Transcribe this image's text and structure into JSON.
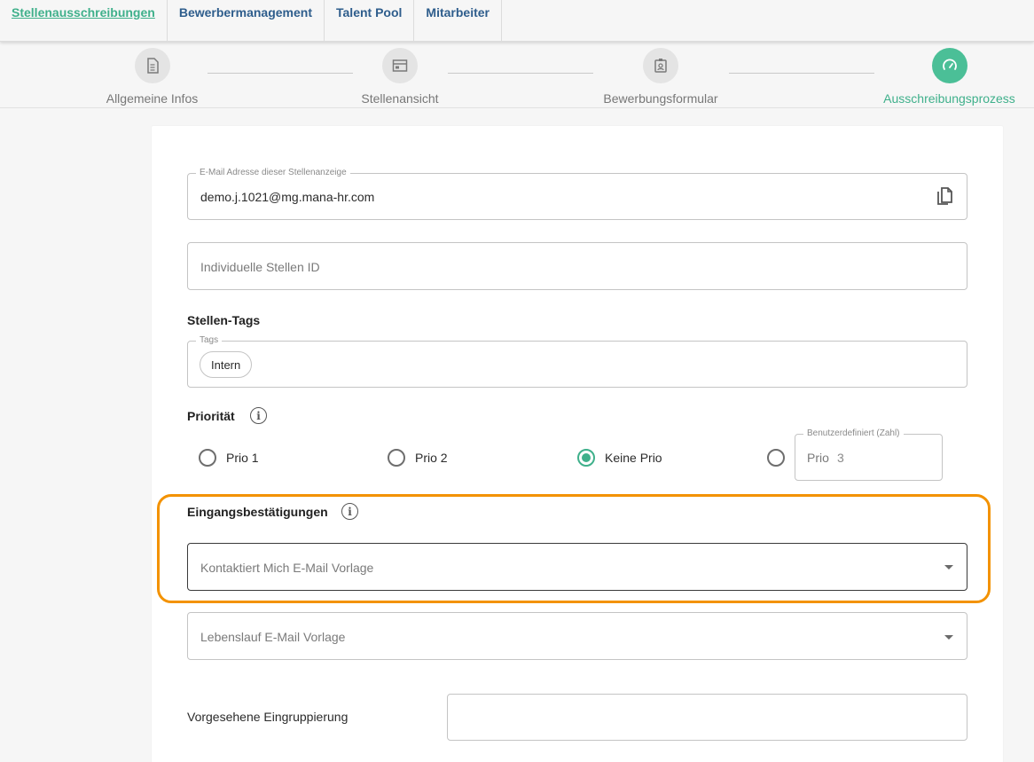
{
  "nav": {
    "tabs": [
      {
        "label": "Stellenausschreibungen",
        "active": true
      },
      {
        "label": "Bewerbermanagement"
      },
      {
        "label": "Talent Pool"
      },
      {
        "label": "Mitarbeiter"
      }
    ]
  },
  "stepper": {
    "steps": [
      {
        "label": "Allgemeine Infos",
        "icon": "document-icon"
      },
      {
        "label": "Stellenansicht",
        "icon": "browser-window-icon"
      },
      {
        "label": "Bewerbungsformular",
        "icon": "id-badge-icon"
      },
      {
        "label": "Ausschreibungsprozess",
        "icon": "speedometer-icon",
        "active": true
      }
    ]
  },
  "form": {
    "email": {
      "legend": "E-Mail Adresse dieser Stellenanzeige",
      "value": "demo.j.1021@mg.mana-hr.com",
      "icon": "copy-icon"
    },
    "stellen_id": {
      "placeholder": "Individuelle Stellen ID"
    },
    "tags_section": {
      "label": "Stellen-Tags",
      "legend": "Tags",
      "chips": [
        "Intern"
      ]
    },
    "priority": {
      "label": "Priorität",
      "options": [
        "Prio 1",
        "Prio 2",
        "Keine Prio"
      ],
      "selected": "Keine Prio",
      "custom": {
        "legend": "Benutzerdefiniert (Zahl)",
        "prefix": "Prio",
        "value": "3"
      }
    },
    "confirmations": {
      "label": "Eingangsbestätigungen",
      "contact_select": "Kontaktiert Mich E-Mail Vorlage",
      "cv_select": "Lebenslauf E-Mail Vorlage"
    },
    "grouping": {
      "label": "Vorgesehene Eingruppierung",
      "value": ""
    }
  },
  "colors": {
    "accent": "#3fb08b",
    "nav_link": "#2e5d8c",
    "highlight": "#f39200"
  }
}
